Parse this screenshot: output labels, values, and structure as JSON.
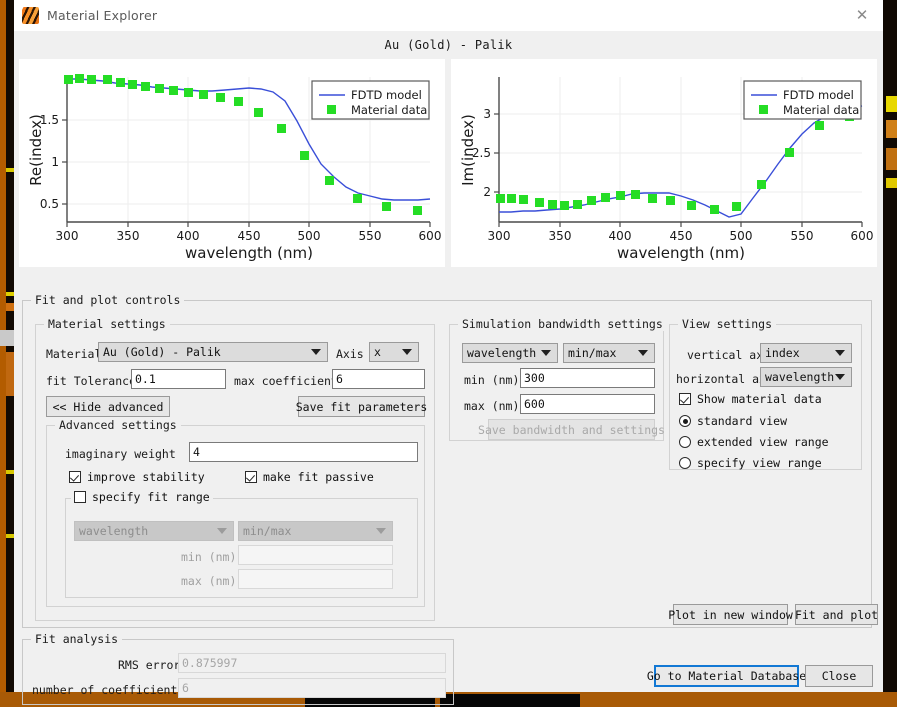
{
  "window": {
    "title": "Material Explorer",
    "icon": "lumerical-app-icon",
    "close_icon": "close-icon"
  },
  "material_heading": "Au (Gold) - Palik",
  "plots": [
    {
      "legend": {
        "line": "FDTD model",
        "marker": "Material data"
      },
      "chart_data": {
        "type": "line",
        "title": "",
        "xlabel": "wavelength (nm)",
        "ylabel": "Re(index)",
        "xlim": [
          300,
          600
        ],
        "ylim": [
          0.22,
          1.9
        ],
        "xticks": [
          300,
          350,
          400,
          450,
          500,
          550,
          600
        ],
        "yticks": [
          0.5,
          1,
          1.5
        ],
        "grid": true,
        "legend_position": "top-right",
        "series": [
          {
            "name": "FDTD model",
            "type": "line",
            "color": "#3a4fd8",
            "x": [
              300,
              310,
              320,
              330,
              340,
              350,
              360,
              370,
              380,
              390,
              400,
              410,
              420,
              430,
              440,
              450,
              460,
              470,
              480,
              490,
              500,
              510,
              520,
              530,
              540,
              550,
              560,
              570,
              580,
              590,
              600
            ],
            "y": [
              1.8,
              1.8,
              1.79,
              1.78,
              1.76,
              1.75,
              1.74,
              1.72,
              1.71,
              1.7,
              1.69,
              1.68,
              1.68,
              1.69,
              1.7,
              1.71,
              1.7,
              1.67,
              1.56,
              1.33,
              1.05,
              0.82,
              0.66,
              0.55,
              0.48,
              0.44,
              0.41,
              0.4,
              0.4,
              0.4,
              0.41
            ]
          },
          {
            "name": "Material data",
            "type": "scatter",
            "color": "#25dd25",
            "x": [
              301,
              310,
              320,
              333,
              344,
              354,
              365,
              376,
              388,
              400,
              413,
              427,
              442,
              458,
              477,
              496,
              517,
              540,
              564,
              590
            ],
            "y": [
              1.8,
              1.81,
              1.8,
              1.8,
              1.76,
              1.74,
              1.72,
              1.7,
              1.68,
              1.66,
              1.64,
              1.61,
              1.56,
              1.43,
              1.24,
              0.92,
              0.62,
              0.41,
              0.31,
              0.26
            ]
          }
        ]
      }
    },
    {
      "legend": {
        "line": "FDTD model",
        "marker": "Material data"
      },
      "chart_data": {
        "type": "line",
        "title": "",
        "xlabel": "wavelength (nm)",
        "ylabel": "Im(index)",
        "xlim": [
          300,
          600
        ],
        "ylim": [
          1.65,
          3.12
        ],
        "xticks": [
          300,
          350,
          400,
          450,
          500,
          550,
          600
        ],
        "yticks": [
          2,
          2.5,
          3
        ],
        "grid": true,
        "legend_position": "top-right",
        "series": [
          {
            "name": "FDTD model",
            "type": "line",
            "color": "#3a4fd8",
            "x": [
              300,
              310,
              320,
              330,
              340,
              350,
              360,
              370,
              380,
              390,
              400,
              410,
              420,
              430,
              440,
              450,
              460,
              470,
              480,
              490,
              500,
              510,
              520,
              530,
              540,
              550,
              560,
              570,
              580,
              590,
              600
            ],
            "y": [
              1.74,
              1.74,
              1.75,
              1.75,
              1.76,
              1.77,
              1.79,
              1.82,
              1.86,
              1.9,
              1.94,
              1.97,
              1.98,
              1.99,
              1.98,
              1.95,
              1.9,
              1.83,
              1.75,
              1.68,
              1.72,
              1.92,
              2.14,
              2.36,
              2.56,
              2.74,
              2.88,
              2.97,
              3.03,
              3.07,
              3.1
            ]
          },
          {
            "name": "Material data",
            "type": "scatter",
            "color": "#25dd25",
            "x": [
              301,
              310,
              320,
              333,
              344,
              354,
              365,
              376,
              388,
              400,
              413,
              427,
              442,
              459,
              478,
              496,
              517,
              540,
              565,
              590
            ],
            "y": [
              1.93,
              1.94,
              1.92,
              1.89,
              1.87,
              1.86,
              1.87,
              1.92,
              1.96,
              1.98,
              1.99,
              1.95,
              1.92,
              1.86,
              1.81,
              1.85,
              2.13,
              2.54,
              2.88,
              3.0
            ]
          }
        ]
      }
    }
  ],
  "fit_and_plot_controls": {
    "legend": "Fit and plot controls",
    "material_settings": {
      "legend": "Material settings",
      "material_label": "Material",
      "material_value": "Au (Gold) - Palik",
      "axis_label": "Axis",
      "axis_value": "x",
      "fit_tolerance_label": "fit Tolerance",
      "fit_tolerance_value": "0.1",
      "max_coefficients_label": "max coefficients",
      "max_coefficients_value": "6",
      "hide_advanced_label": "<< Hide advanced",
      "save_fit_parameters_label": "Save fit parameters"
    },
    "advanced_settings": {
      "legend": "Advanced settings",
      "imaginary_weight_label": "imaginary weight",
      "imaginary_weight_value": "4",
      "improve_stability_label": "improve stability",
      "improve_stability_checked": true,
      "make_fit_passive_label": "make fit passive",
      "make_fit_passive_checked": true,
      "specify_fit_range_label": "specify fit range",
      "specify_fit_range_checked": false,
      "quantity_value": "wavelength",
      "mode_value": "min/max",
      "min_label": "min (nm)",
      "min_value": "",
      "max_label": "max (nm)",
      "max_value": ""
    },
    "simulation_bandwidth": {
      "legend": "Simulation bandwidth settings",
      "quantity_value": "wavelength",
      "mode_value": "min/max",
      "min_label": "min (nm)",
      "min_value": "300",
      "max_label": "max (nm)",
      "max_value": "600",
      "save_button_label": "Save bandwidth and settings"
    },
    "view_settings": {
      "legend": "View settings",
      "vertical_axis_label": "vertical axis",
      "vertical_axis_value": "index",
      "horizontal_axis_label": "horizontal axis",
      "horizontal_axis_value": "wavelength",
      "show_material_data_label": "Show material data",
      "show_material_data_checked": true,
      "radios": [
        {
          "label": "standard view",
          "selected": true
        },
        {
          "label": "extended view range",
          "selected": false
        },
        {
          "label": "specify view range",
          "selected": false
        }
      ]
    },
    "plot_in_new_window_label": "Plot in new window",
    "fit_and_plot_label": "Fit and plot"
  },
  "fit_analysis": {
    "legend": "Fit analysis",
    "rms_error_label": "RMS error",
    "rms_error_value": "0.875997",
    "num_coefficients_label": "number of coefficients",
    "num_coefficients_value": "6"
  },
  "footer": {
    "go_to_material_database_label": "Go to Material Database",
    "close_label": "Close"
  },
  "colors": {
    "model_line": "#3a4fd8",
    "material_marker": "#25dd25",
    "focus_ring": "#1278d4",
    "window_bg": "#f0f0f0"
  }
}
